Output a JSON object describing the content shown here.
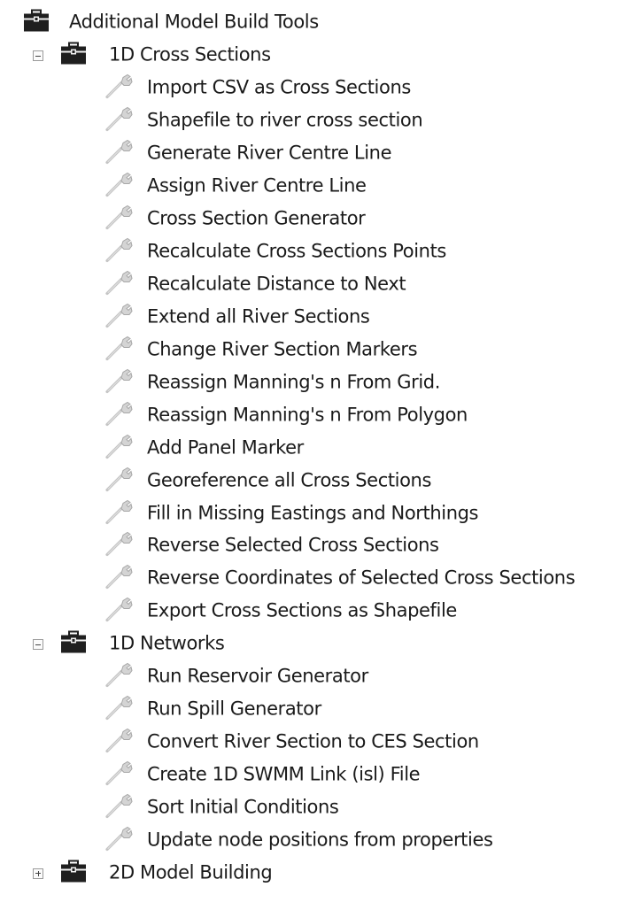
{
  "tree": {
    "root_label": "Additional Model Build Tools",
    "groups": [
      {
        "label": "1D Cross Sections",
        "expanded": true,
        "items": [
          "Import CSV as Cross Sections",
          "Shapefile to river cross section",
          "Generate River Centre Line",
          "Assign River Centre Line",
          "Cross Section Generator",
          "Recalculate Cross Sections Points",
          "Recalculate Distance to Next",
          "Extend all River Sections",
          "Change River Section Markers",
          "Reassign Manning's n From Grid.",
          "Reassign Manning's n From Polygon",
          "Add Panel Marker",
          "Georeference all Cross Sections",
          "Fill in Missing Eastings and Northings",
          "Reverse Selected Cross Sections",
          "Reverse Coordinates of Selected Cross Sections",
          "Export Cross Sections as Shapefile"
        ]
      },
      {
        "label": "1D Networks",
        "expanded": true,
        "items": [
          "Run Reservoir Generator",
          "Run Spill Generator",
          "Convert River Section to CES Section",
          "Create 1D SWMM Link (isl) File",
          "Sort Initial Conditions",
          "Update node positions from properties"
        ]
      },
      {
        "label": "2D Model Building",
        "expanded": false,
        "items": []
      }
    ]
  },
  "icons": {
    "toolbox": "toolbox-icon",
    "tool": "tool-script-icon",
    "expanded_toggle": "collapse-icon",
    "collapsed_toggle": "expand-icon"
  },
  "colors": {
    "toolbox_body": "#1f1f1f",
    "toolbox_stripe": "#f2f2f2",
    "tool_icon": "#b8b8b8",
    "text": "#1a1a1a",
    "toggle_border": "#9a9a9a"
  }
}
